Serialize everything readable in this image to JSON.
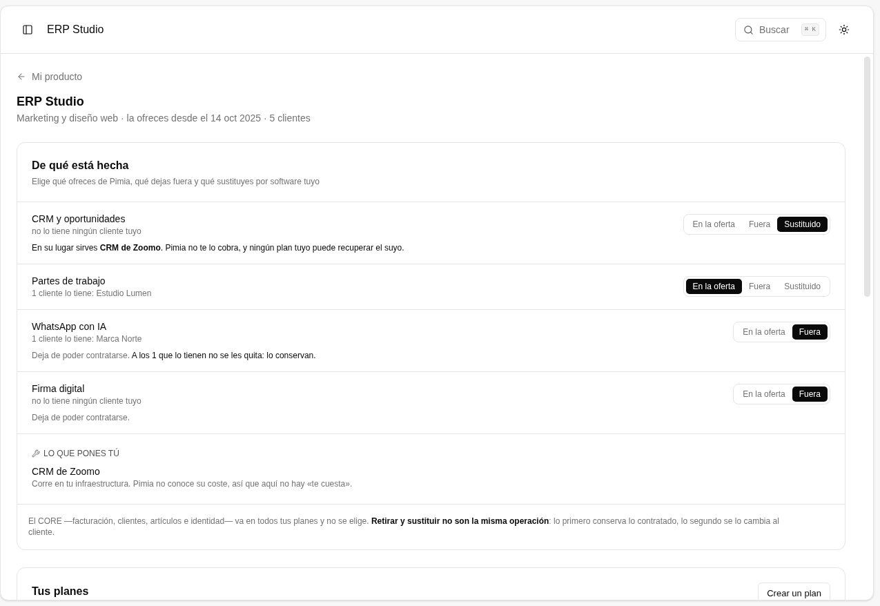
{
  "header": {
    "title": "ERP Studio",
    "search": {
      "label": "Buscar",
      "shortcut": "⌘ K"
    }
  },
  "breadcrumb": {
    "label": "Mi producto"
  },
  "page": {
    "title": "ERP Studio",
    "subtitle": "Marketing y diseño web · la ofreces desde el 14 oct 2025 · 5 clientes"
  },
  "composition": {
    "title": "De qué está hecha",
    "subtitle": "Elige qué ofreces de Pimia, qué dejas fuera y qué sustituyes por software tuyo",
    "modules": [
      {
        "name": "CRM y oportunidades",
        "clients": "no lo tiene ningún cliente tuyo",
        "options": [
          {
            "label": "En la oferta",
            "selected": false
          },
          {
            "label": "Fuera",
            "selected": false
          },
          {
            "label": "Sustituido",
            "selected": true
          }
        ],
        "note": [
          {
            "text": "En su lugar sirves **CRM de Zoomo**. Pimia no te lo cobra, y ningún plan tuyo puede recuperar el suyo.",
            "muted": false
          }
        ]
      },
      {
        "name": "Partes de trabajo",
        "clients": "1 cliente lo tiene: Estudio Lumen",
        "options": [
          {
            "label": "En la oferta",
            "selected": true
          },
          {
            "label": "Fuera",
            "selected": false
          },
          {
            "label": "Sustituido",
            "selected": false
          }
        ]
      },
      {
        "name": "WhatsApp con IA",
        "clients": "1 cliente lo tiene: Marca Norte",
        "options": [
          {
            "label": "En la oferta",
            "selected": false
          },
          {
            "label": "Fuera",
            "selected": true
          }
        ],
        "note": [
          {
            "text": "Deja de poder contratarse.",
            "muted": true
          },
          {
            "text": "A los 1 que lo tienen no se les quita: lo conservan.",
            "muted": false
          }
        ]
      },
      {
        "name": "Firma digital",
        "clients": "no lo tiene ningún cliente tuyo",
        "options": [
          {
            "label": "En la oferta",
            "selected": false
          },
          {
            "label": "Fuera",
            "selected": true
          }
        ],
        "note": [
          {
            "text": "Deja de poder contratarse.",
            "muted": true
          }
        ]
      }
    ],
    "own_software": {
      "heading": "LO QUE PONES TÚ",
      "items": [
        {
          "name": "CRM de Zoomo",
          "description": "Corre en tu infraestructura. Pimia no conoce su coste, así que aquí no hay «te cuesta»."
        }
      ]
    },
    "footnote": "El CORE —facturación, clientes, artículos e identidad— va en todos tus planes y no se elige. **Retirar y sustituir no son la misma operación**: lo primero conserva lo contratado, lo segundo se lo cambia al cliente."
  },
  "plans": {
    "title": "Tus planes",
    "button": "Crear un plan"
  }
}
